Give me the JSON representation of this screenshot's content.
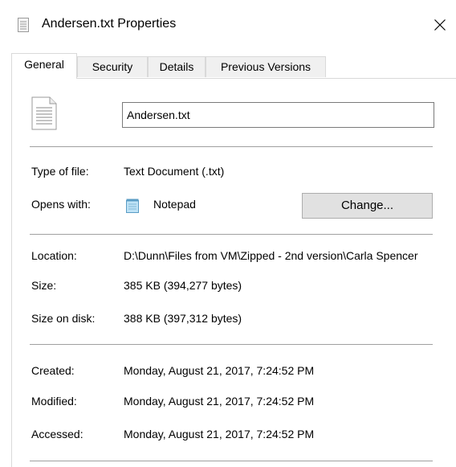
{
  "window": {
    "title": "Andersen.txt Properties",
    "close_label": "×"
  },
  "tabs": [
    {
      "label": "General",
      "active": true
    },
    {
      "label": "Security",
      "active": false
    },
    {
      "label": "Details",
      "active": false
    },
    {
      "label": "Previous Versions",
      "active": false
    }
  ],
  "general": {
    "filename": "Andersen.txt",
    "type_label": "Type of file:",
    "type_value": "Text Document (.txt)",
    "opens_label": "Opens with:",
    "opens_value": "Notepad",
    "change_button": "Change...",
    "location_label": "Location:",
    "location_value": "D:\\Dunn\\Files from VM\\Zipped - 2nd version\\Carla Spencer",
    "size_label": "Size:",
    "size_value": "385 KB (394,277 bytes)",
    "size_on_disk_label": "Size on disk:",
    "size_on_disk_value": "388 KB (397,312 bytes)",
    "created_label": "Created:",
    "created_value": "Monday, August 21, 2017, 7:24:52 PM",
    "modified_label": "Modified:",
    "modified_value": "Monday, August 21, 2017, 7:24:52 PM",
    "accessed_label": "Accessed:",
    "accessed_value": "Monday, August 21, 2017, 7:24:52 PM"
  },
  "icons": {
    "title": "text-file-icon",
    "file": "text-document-icon",
    "notepad": "notepad-icon",
    "close": "close-icon"
  }
}
